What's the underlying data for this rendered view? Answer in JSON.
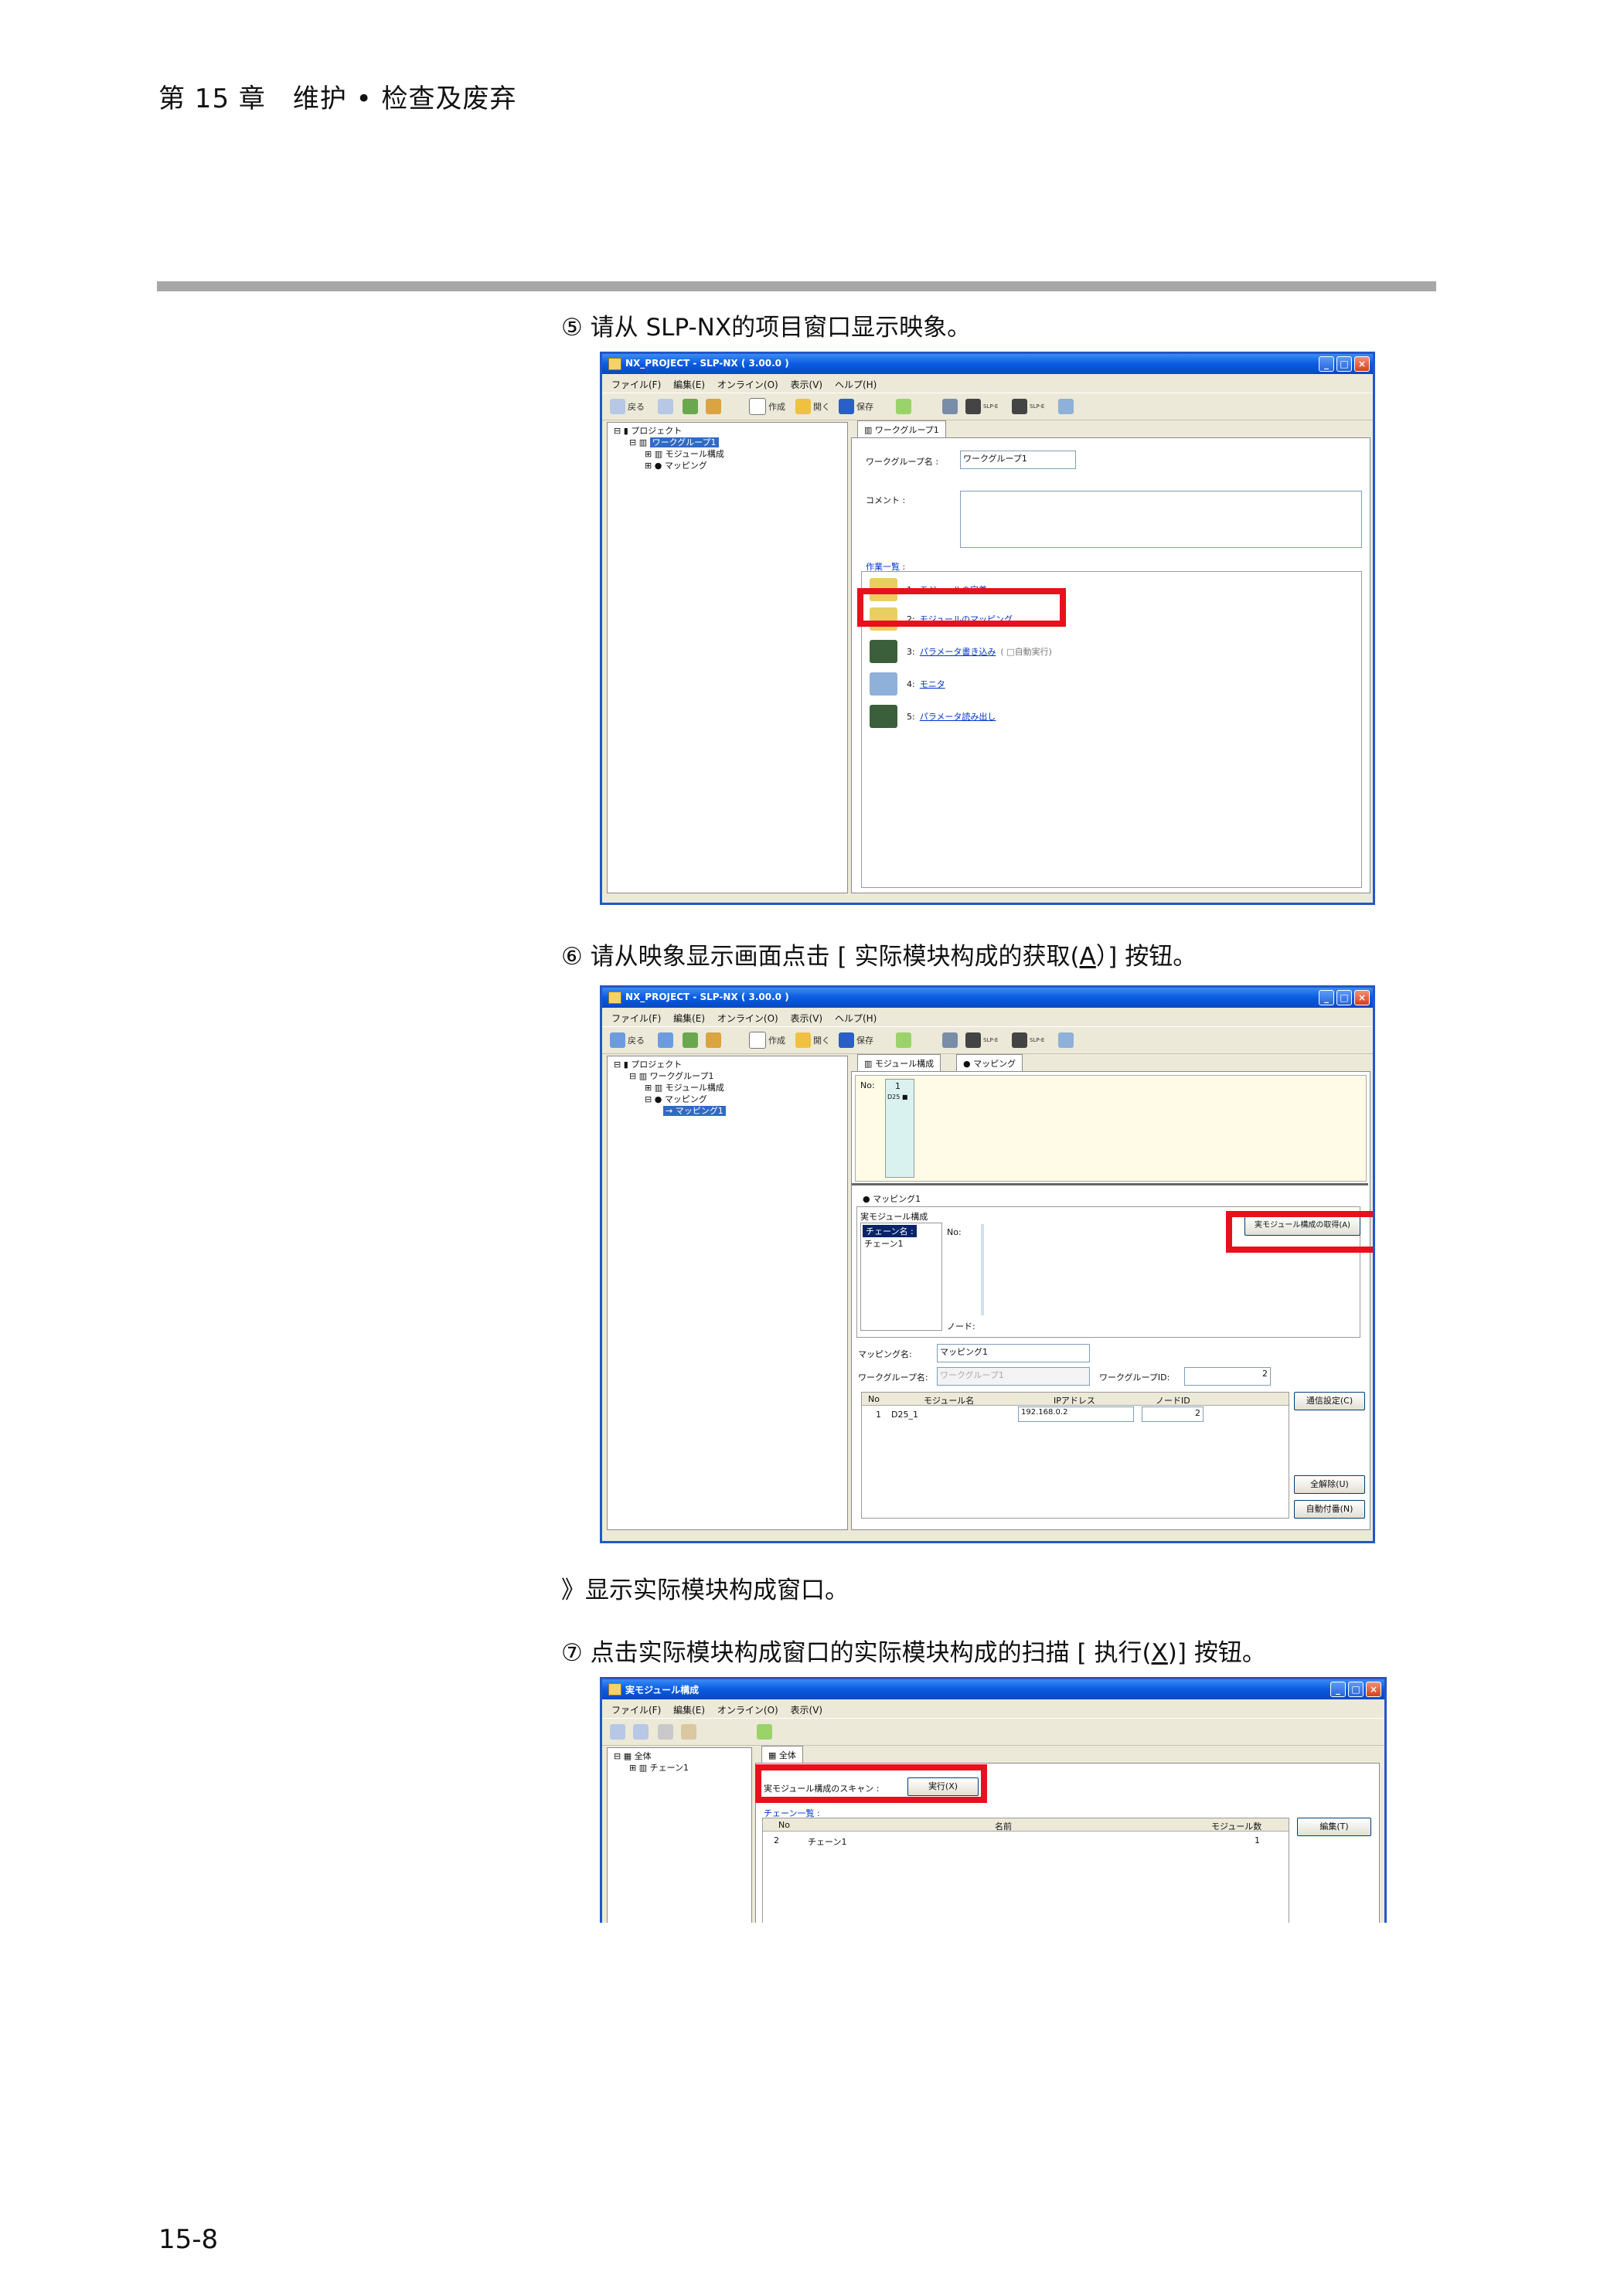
{
  "header": {
    "chapter": "第 15 章　维护 • 检查及废弃"
  },
  "page_number": "15-8",
  "steps": [
    {
      "text": "⑤ 请从 SLP-NX的项目窗口显示映象。"
    },
    {
      "text_before": "⑥ 请从映象显示画面点击 [ 实际模块构成的获取(",
      "key": "A",
      "text_after": "）] 按钮。"
    },
    {
      "text": "》显示实际模块构成窗口。"
    },
    {
      "text_before": "⑦ 点击实际模块构成窗口的实际模块构成的扫描 [ 执行(",
      "key": "X",
      "text_after": ")] 按钮。"
    }
  ],
  "win1": {
    "title": "NX_PROJECT - SLP-NX ( 3.00.0 )",
    "menus": [
      "ファイル(F)",
      "編集(E)",
      "オンライン(O)",
      "表示(V)",
      "ヘルプ(H)"
    ],
    "toolbar": {
      "back": "戻る",
      "create": "作成",
      "open": "開く",
      "save": "保存",
      "slp1": "SLP-E",
      "slp2": "SLP-E"
    },
    "tree": {
      "root": "プロジェクト",
      "group": "ワークグループ1",
      "module": "モジュール構成",
      "mapping": "マッピング"
    },
    "tab": "ワークグループ1",
    "name_label": "ワークグループ名 :",
    "name_value": "ワークグループ1",
    "comment_label": "コメント :",
    "tasks_label": "作業一覧 :",
    "tasks": [
      {
        "num": "1:",
        "label": "モジュールの定義",
        "extra": ""
      },
      {
        "num": "2:",
        "label": "モジュールのマッピング",
        "extra": ""
      },
      {
        "num": "3:",
        "label": "パラメータ書き込み",
        "extra": "( □自動実行)"
      },
      {
        "num": "4:",
        "label": "モニタ",
        "extra": ""
      },
      {
        "num": "5:",
        "label": "パラメータ読み出し",
        "extra": ""
      }
    ]
  },
  "win2": {
    "title": "NX_PROJECT - SLP-NX ( 3.00.0 )",
    "menus": [
      "ファイル(F)",
      "編集(E)",
      "オンライン(O)",
      "表示(V)",
      "ヘルプ(H)"
    ],
    "toolbar": {
      "back": "戻る",
      "create": "作成",
      "open": "開く",
      "save": "保存",
      "slp1": "SLP-E",
      "slp2": "SLP-E"
    },
    "tree": {
      "root": "プロジェクト",
      "group": "ワークグループ1",
      "module": "モジュール構成",
      "mapping": "マッピング",
      "mapping1": "マッピング1"
    },
    "tabs": [
      "モジュール構成",
      "マッピング"
    ],
    "no_label": "No:",
    "no_value": "1",
    "cell": "D25 ■",
    "subtab": "マッピング1",
    "real_label": "実モジュール構成",
    "chain_header": "チェーン名 :",
    "chain_item": "チェーン1",
    "no2_label": "No:",
    "node_label": "ノード:",
    "acquire_button": "実モジュール構成の取得(A)",
    "mapname_label": "マッピング名:",
    "mapname_value": "マッピング1",
    "wg_label": "ワークグループ名:",
    "wg_value": "ワークグループ1",
    "wgid_label": "ワークグループID:",
    "wgid_value": "2",
    "table_headers": [
      "No",
      "モジュール名",
      "IPアドレス",
      "ノードID"
    ],
    "table_rows": [
      [
        "1",
        "D25_1",
        "192.168.0.2",
        "2"
      ]
    ],
    "btn_comm": "通信設定(C)",
    "btn_clear": "全解除(U)",
    "btn_auto": "自動付番(N)"
  },
  "win3": {
    "title": "実モジュール構成",
    "menus": [
      "ファイル(F)",
      "編集(E)",
      "オンライン(O)",
      "表示(V)"
    ],
    "tree": {
      "root": "全体",
      "chain": "チェーン1"
    },
    "tab": "全体",
    "scan_label": "実モジュール構成のスキャン :",
    "exec_button": "実行(X)",
    "list_label": "チェーン一覧 :",
    "table_headers": [
      "No",
      "名前",
      "モジュール数"
    ],
    "table_rows": [
      [
        "2",
        "チェーン1",
        "1"
      ]
    ],
    "edit_button": "編集(T)"
  },
  "colors": {
    "highlight": "#e8101c",
    "titlebar": "#0a5be0",
    "rule": "#a7a7a7"
  }
}
